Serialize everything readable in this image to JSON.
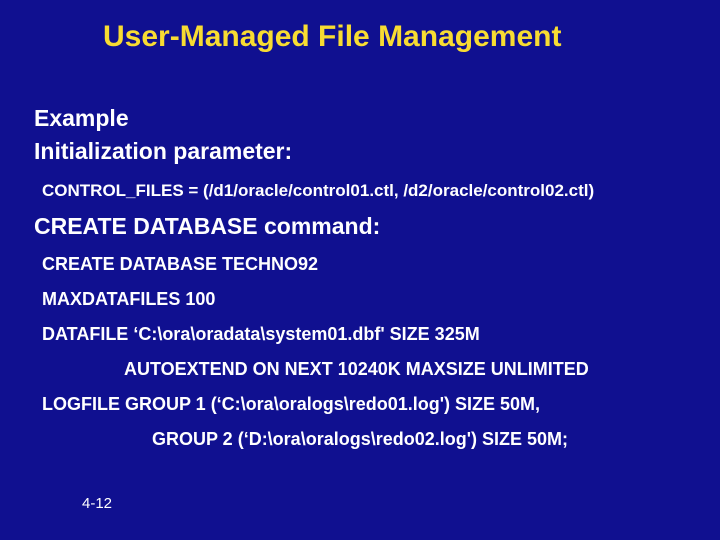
{
  "title": "User-Managed File Management",
  "sections": {
    "example": "Example",
    "initParamHeader": "Initialization parameter:",
    "controlFilesLine": "CONTROL_FILES = (/d1/oracle/control01.ctl, /d2/oracle/control02.ctl)",
    "createDbHeader": "CREATE DATABASE command:",
    "lines": {
      "l1": "CREATE DATABASE TECHNO92",
      "l2": "MAXDATAFILES 100",
      "l3": "DATAFILE ‘C:\\ora\\oradata\\system01.dbf' SIZE 325M",
      "l4": "AUTOEXTEND ON NEXT 10240K MAXSIZE UNLIMITED",
      "l5": "LOGFILE GROUP 1 (‘C:\\ora\\oralogs\\redo01.log') SIZE 50M,",
      "l6": "GROUP 2 (‘D:\\ora\\oralogs\\redo02.log') SIZE 50M;"
    }
  },
  "footer": "4-12"
}
